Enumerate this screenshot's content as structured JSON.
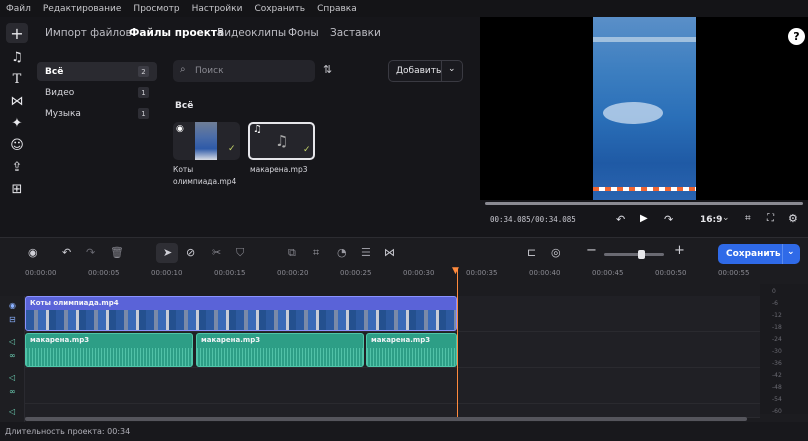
{
  "menu": [
    "Файл",
    "Редактирование",
    "Просмотр",
    "Настройки",
    "Сохранить",
    "Справка"
  ],
  "library": {
    "tabs": [
      "Импорт файлов",
      "Файлы проекта",
      "Видеоклипы",
      "Фоны",
      "Заставки"
    ],
    "active_tab": 1,
    "categories": [
      {
        "label": "Всё",
        "count": "2"
      },
      {
        "label": "Видео",
        "count": "1"
      },
      {
        "label": "Музыка",
        "count": "1"
      }
    ],
    "search_placeholder": "Поиск",
    "add_button": "Добавить",
    "section_title": "Всё",
    "files": [
      {
        "name": "Коты олимпиада.mp4",
        "type": "video"
      },
      {
        "name": "макарена.mp3",
        "type": "audio"
      }
    ]
  },
  "player": {
    "timecode": "00:34.085/00:34.085",
    "aspect": "16:9",
    "help": "?"
  },
  "timeline": {
    "save_button": "Сохранить",
    "ruler": [
      "00:00:00",
      "00:00:05",
      "00:00:10",
      "00:00:15",
      "00:00:20",
      "00:00:25",
      "00:00:30",
      "00:00:35",
      "00:00:40",
      "00:00:45",
      "00:00:50",
      "00:00:55"
    ],
    "video_clip": "Коты олимпиада.mp4",
    "audio_clips": [
      "макарена.mp3",
      "макарена.mp3",
      "макарена.mp3"
    ],
    "meter_labels": [
      "0",
      "-6",
      "-12",
      "-18",
      "-24",
      "-30",
      "-36",
      "-42",
      "-48",
      "-54",
      "-60"
    ]
  },
  "status": {
    "duration": "Длительность проекта: 00:34"
  }
}
